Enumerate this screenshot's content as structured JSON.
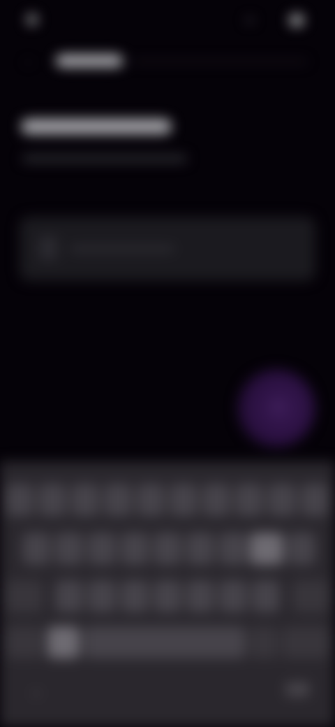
{
  "status_bar": {
    "time": "",
    "battery": ""
  },
  "header": {
    "back_icon": "arrow-left-icon",
    "label": ""
  },
  "page": {
    "title": "",
    "subtitle": ""
  },
  "input": {
    "value": "",
    "placeholder": "",
    "icon": "document-icon"
  },
  "fab": {
    "icon": "mic-icon",
    "color": "#2a1040"
  },
  "keyboard": {
    "rows": [
      [
        "",
        "",
        "",
        "",
        "",
        "",
        "",
        "",
        "",
        ""
      ],
      [
        "",
        "",
        "",
        "",
        "",
        "",
        "",
        "",
        ""
      ],
      [
        "",
        "",
        "",
        "",
        "",
        "",
        "",
        "",
        ""
      ],
      [
        "",
        "",
        "",
        "",
        ""
      ]
    ],
    "nav": {
      "left_icon": "chevron-down-icon",
      "right_icon": "keyboard-icon"
    }
  },
  "colors": {
    "background": "#050208",
    "keyboard": "#2a272d",
    "key": "#46434a",
    "accent": "#3a1a55"
  }
}
